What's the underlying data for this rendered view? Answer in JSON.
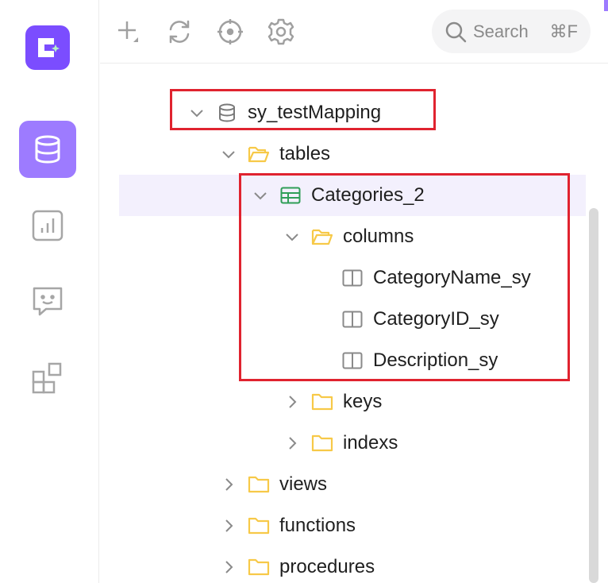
{
  "search": {
    "placeholder": "Search",
    "shortcut": "⌘F"
  },
  "rail": {
    "items": [
      {
        "id": "database",
        "icon": "database-icon",
        "active": true
      },
      {
        "id": "dashboard",
        "icon": "bar-chart-icon",
        "active": false
      },
      {
        "id": "chat",
        "icon": "chat-icon",
        "active": false
      },
      {
        "id": "plugins",
        "icon": "grid-plus-icon",
        "active": false
      }
    ]
  },
  "toolbar": {
    "icons": [
      "add-icon",
      "refresh-icon",
      "locate-icon",
      "gear-icon"
    ]
  },
  "tree": {
    "root": "sy_testMapping",
    "tables_folder": "tables",
    "table": "Categories_2",
    "columns_folder": "columns",
    "columns": [
      "CategoryName_sy",
      "CategoryID_sy",
      "Description_sy"
    ],
    "keys_folder": "keys",
    "indexs_folder": "indexs",
    "views_folder": "views",
    "functions_folder": "functions",
    "procedures_folder": "procedures"
  },
  "colors": {
    "accent": "#7b4dff",
    "accent_light": "#9d7bff",
    "folder": "#f7c948",
    "table_icon": "#2f9e57",
    "highlight": "#e0232f"
  }
}
